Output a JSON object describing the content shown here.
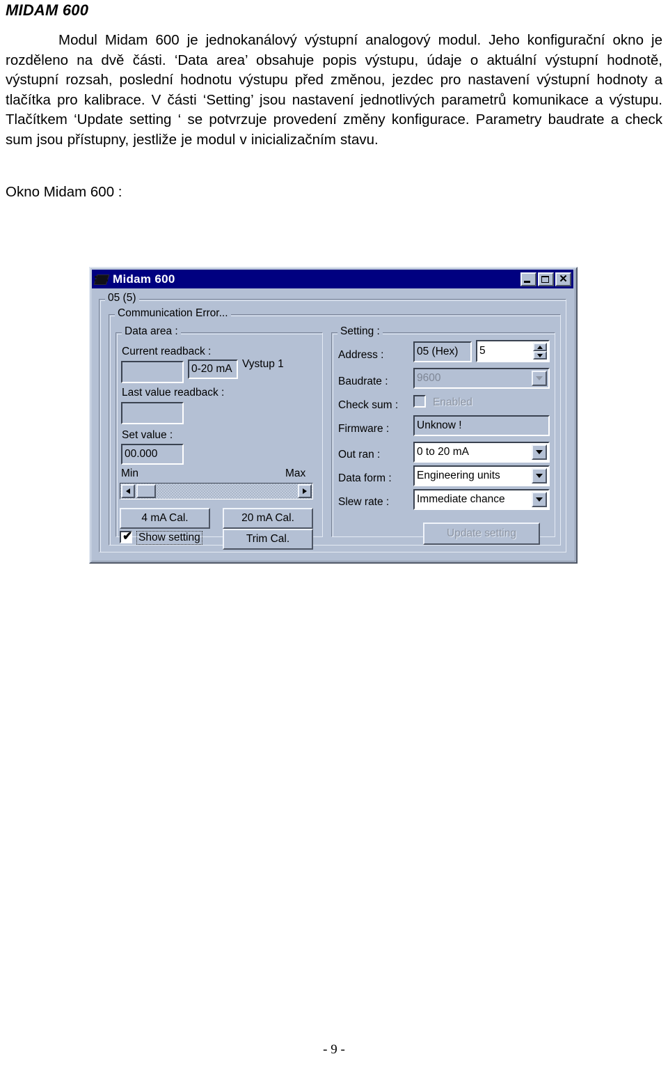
{
  "document": {
    "heading": "MIDAM 600",
    "paragraph": "Modul Midam 600 je jednokanálový výstupní analogový modul. Jeho konfigurační okno je rozděleno na dvě části. ‘Data area’ obsahuje popis výstupu, údaje o aktuální výstupní hodnotě, výstupní rozsah, poslední hodnotu výstupu před změnou, jezdec pro nastavení výstupní hodnoty a tlačítka pro kalibrace. V části ‘Setting’ jsou nastavení jednotlivých parametrů komunikace a výstupu. Tlačítkem ‘Update setting ‘ se potvrzuje provedení změny konfigurace. Parametry baudrate a  check sum jsou přístupny, jestliže je modul v inicializačním stavu.",
    "caption": "Okno Midam 600 :",
    "page_number": "- 9 -"
  },
  "dialog": {
    "title": "Midam 600",
    "title_icon": "chip-icon",
    "titlebar_color": "#000080",
    "face_color": "#b4c0d4",
    "buttons": {
      "minimize": "minimize-icon",
      "maximize": "maximize-icon",
      "close": "close-icon"
    },
    "outer_group_label": "05 (5)",
    "status_group_label": "Communication Error...",
    "data_area": {
      "group_label": "Data area :",
      "current_readback_label": "Current readback :",
      "current_readback_value": "",
      "range_value": "0-20 mA",
      "channel_name": "Vystup 1",
      "last_value_readback_label": "Last value readback :",
      "last_value_readback_value": "",
      "set_value_label": "Set value :",
      "set_value": "00.000",
      "slider_min_label": "Min",
      "slider_max_label": "Max",
      "btn_4ma_cal": "4 mA Cal.",
      "btn_20ma_cal": "20 mA Cal.",
      "btn_trim_cal": "Trim Cal.",
      "show_setting_label": "Show setting",
      "show_setting_checked": true
    },
    "setting": {
      "group_label": "Setting :",
      "address_label": "Address :",
      "address_hex": "05 (Hex)",
      "address_dec": "5",
      "baudrate_label": "Baudrate :",
      "baudrate_value": "9600",
      "baudrate_disabled": true,
      "check_sum_label": "Check sum :",
      "check_sum_option": "Enabled",
      "check_sum_checked": false,
      "check_sum_disabled": true,
      "firmware_label": "Firmware :",
      "firmware_value": "Unknow !",
      "out_ran_label": "Out ran :",
      "out_ran_value": "0 to 20 mA",
      "data_form_label": "Data form :",
      "data_form_value": "Engineering units",
      "slew_rate_label": "Slew rate :",
      "slew_rate_value": "Immediate chance",
      "update_button": "Update setting",
      "update_disabled": true
    }
  }
}
